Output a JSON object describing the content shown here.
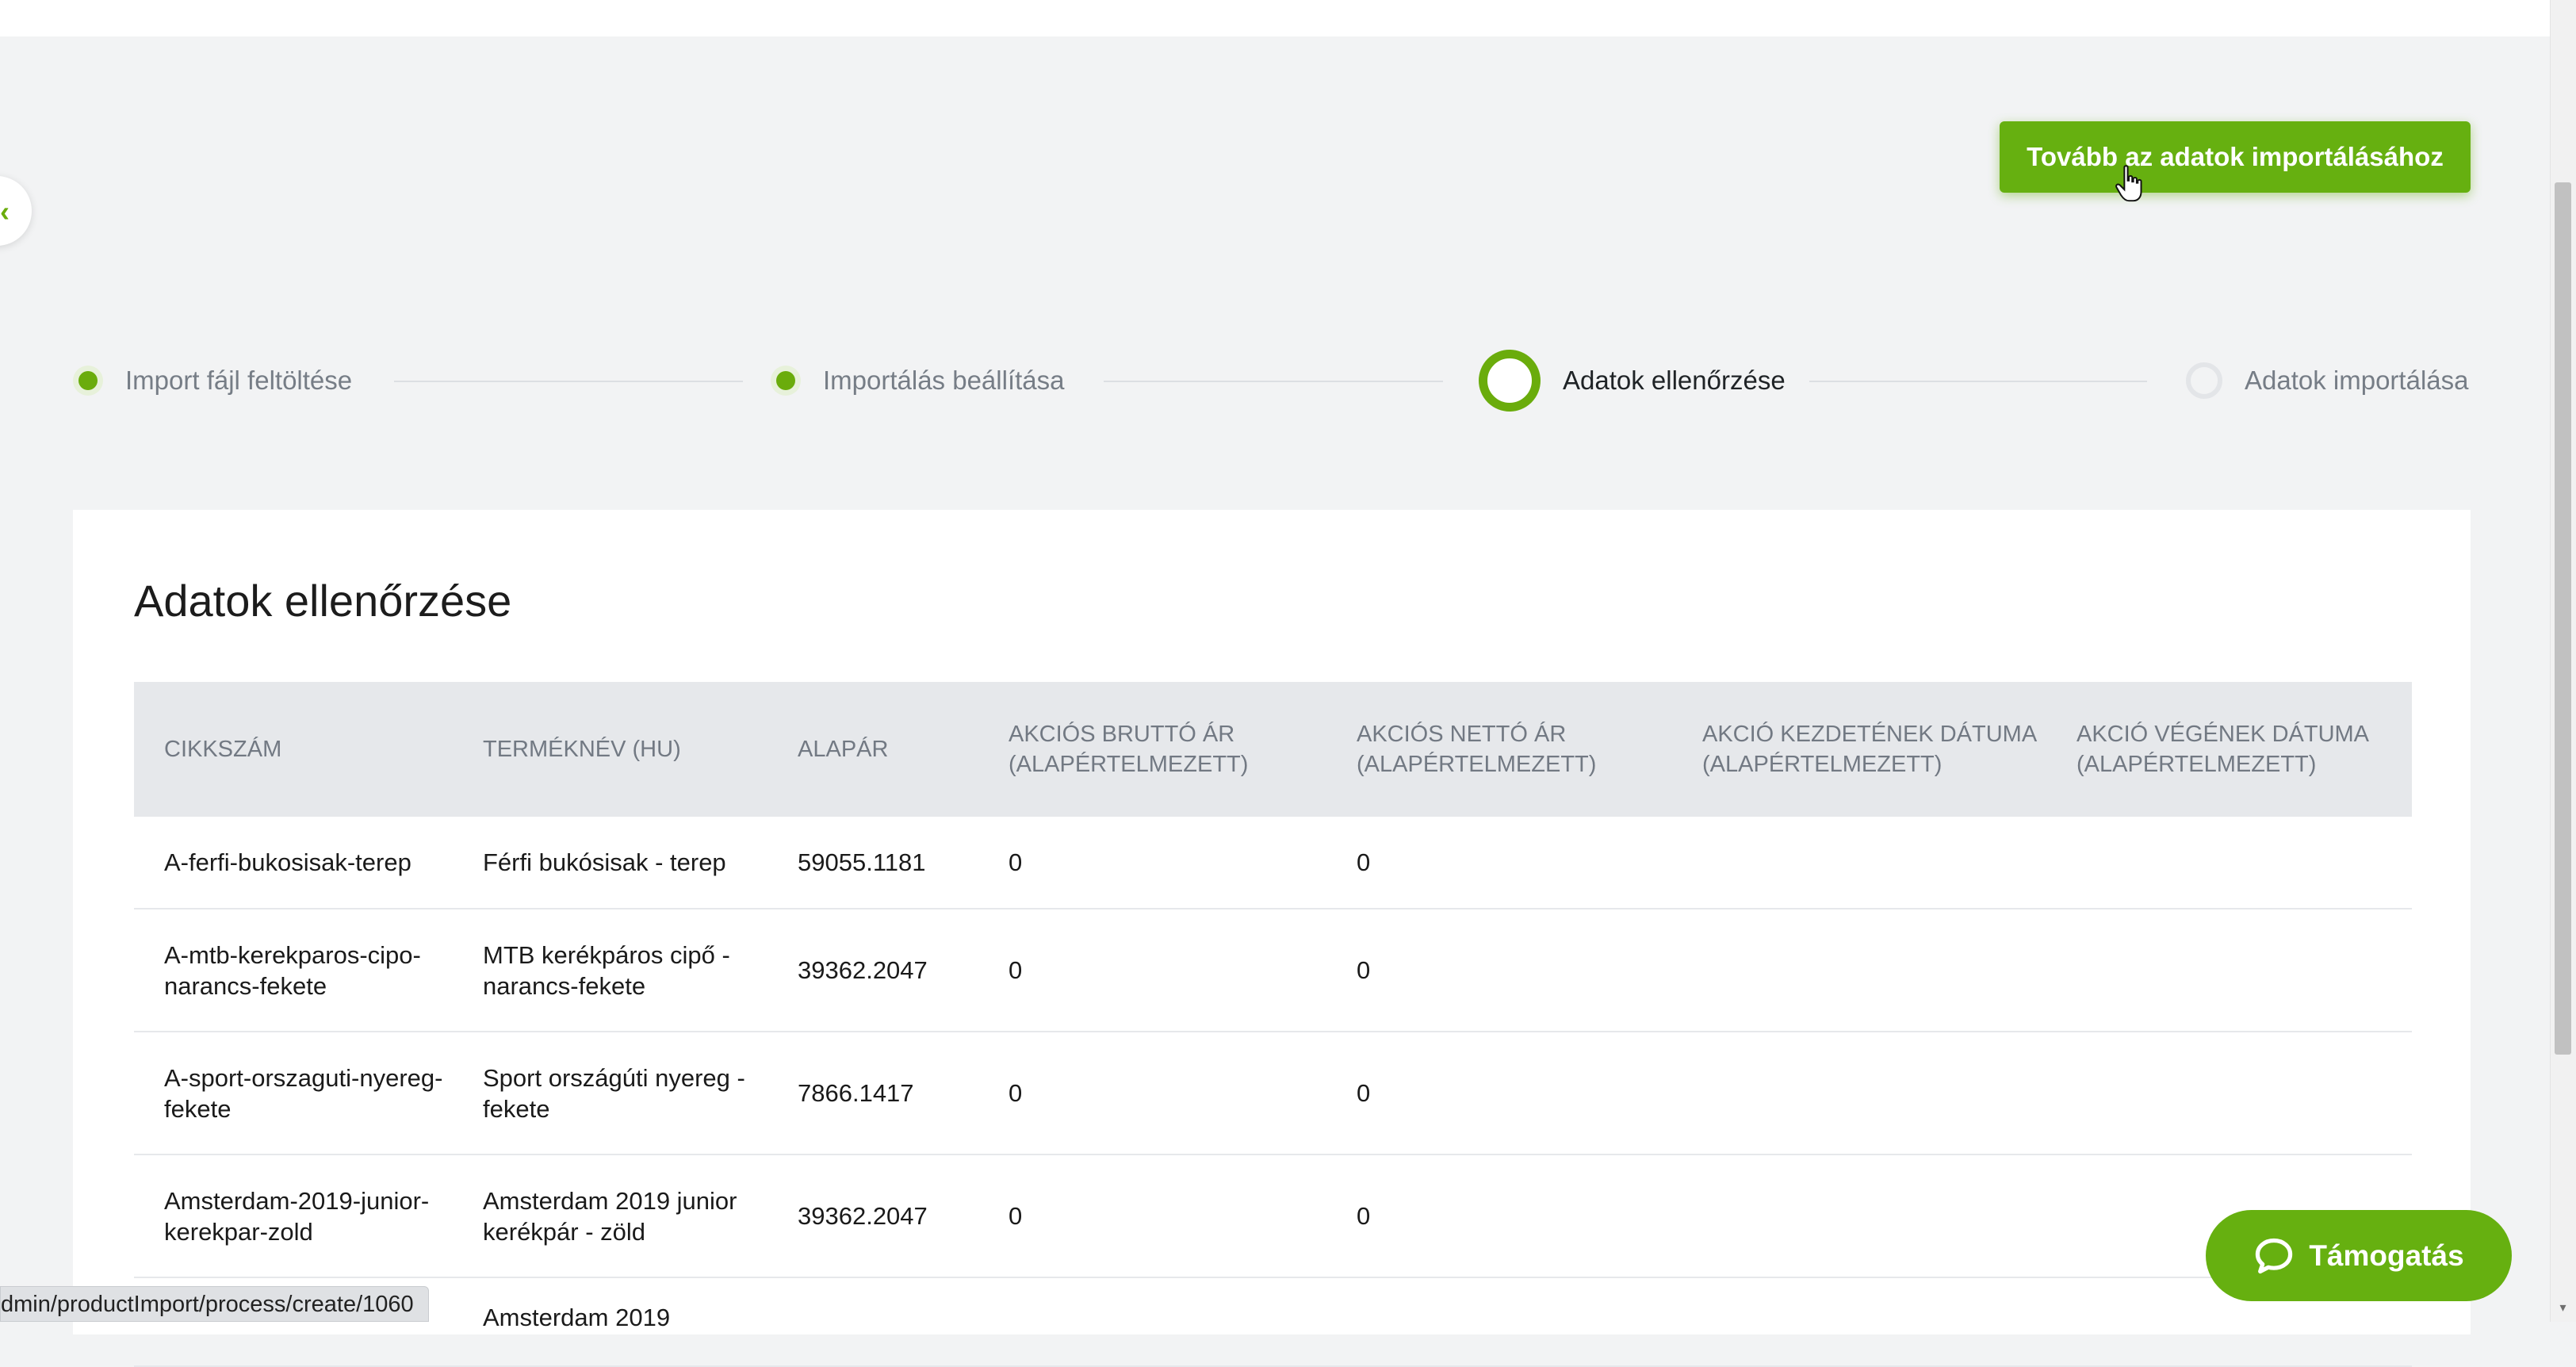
{
  "header": {
    "next_button_label": "Tovább az adatok importálásához"
  },
  "stepper": {
    "steps": [
      {
        "label": "Import fájl feltöltése",
        "state": "done"
      },
      {
        "label": "Importálás beállítása",
        "state": "done"
      },
      {
        "label": "Adatok ellenőrzése",
        "state": "active"
      },
      {
        "label": "Adatok importálása",
        "state": "pending"
      }
    ]
  },
  "card": {
    "title": "Adatok ellenőrzése",
    "columns": [
      "CIKKSZÁM",
      "TERMÉKNÉV (HU)",
      "ALAPÁR",
      "AKCIÓS BRUTTÓ ÁR (ALAPÉRTELMEZETT)",
      "AKCIÓS NETTÓ ÁR (ALAPÉRTELMEZETT)",
      "AKCIÓ KEZDETÉNEK DÁTUMA (ALAPÉRTELMEZETT)",
      "AKCIÓ VÉGÉNEK DÁTUMA (ALAPÉRTELMEZETT)"
    ],
    "rows": [
      [
        "A-ferfi-bukosisak-terep",
        "Férfi bukósisak - terep",
        "59055.1181",
        "0",
        "0",
        "",
        ""
      ],
      [
        "A-mtb-kerekparos-cipo-narancs-fekete",
        "MTB kerékpáros cipő - narancs-fekete",
        "39362.2047",
        "0",
        "0",
        "",
        ""
      ],
      [
        "A-sport-orszaguti-nyereg-fekete",
        "Sport országúti nyereg - fekete",
        "7866.1417",
        "0",
        "0",
        "",
        ""
      ],
      [
        "Amsterdam-2019-junior-kerekpar-zold",
        "Amsterdam 2019 junior kerékpár - zöld",
        "39362.2047",
        "0",
        "0",
        "",
        ""
      ],
      [
        "",
        "Amsterdam 2019",
        "",
        "",
        "",
        "",
        ""
      ]
    ]
  },
  "status_bar": {
    "url": "dmin/productImport/process/create/1060"
  },
  "support": {
    "label": "Támogatás",
    "icon": "chat-bubble-icon"
  },
  "colors": {
    "accent": "#66b010",
    "background": "#f2f3f4",
    "table_header": "#e6e8eb"
  }
}
